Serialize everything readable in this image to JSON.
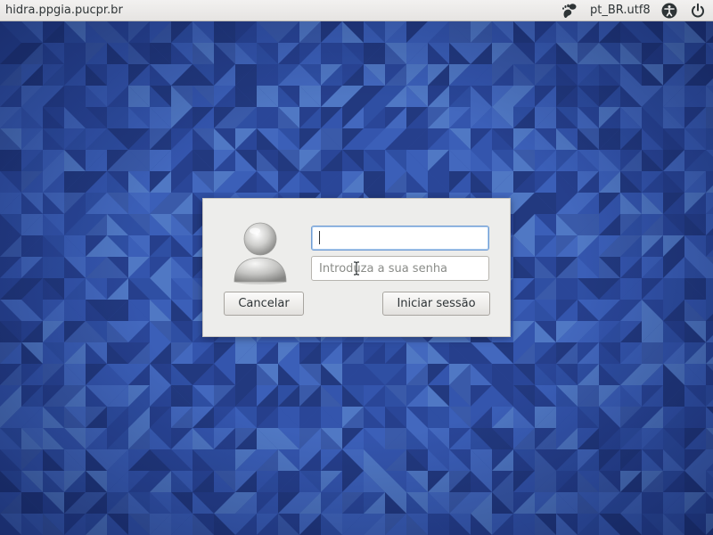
{
  "top_panel": {
    "hostname": "hidra.ppgia.pucpr.br",
    "locale": "pt_BR.utf8",
    "icons": [
      "gnome-foot-icon",
      "accessibility-icon",
      "power-icon"
    ]
  },
  "login_dialog": {
    "avatar_icon": "user-avatar-icon",
    "username": {
      "value": "",
      "placeholder": ""
    },
    "password": {
      "value": "",
      "placeholder": "Introduza a sua senha"
    },
    "cancel_label": "Cancelar",
    "login_label": "Iniciar sessão"
  },
  "colors": {
    "background_blue": "#2f4fa3",
    "panel": "#f2f1f0",
    "dialog": "#ededeb",
    "focus_border": "#6f9bd3"
  }
}
